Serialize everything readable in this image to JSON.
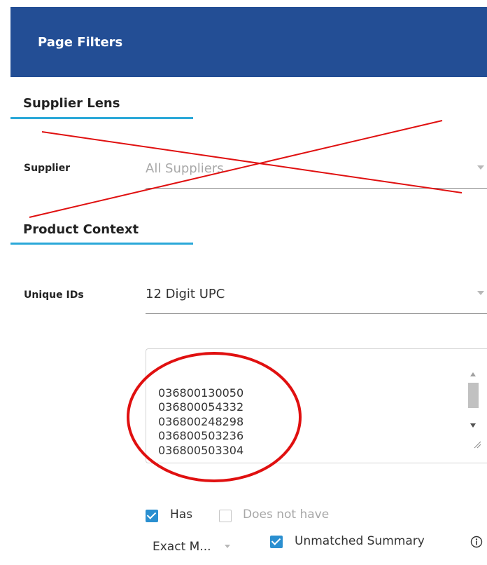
{
  "header": {
    "title": "Page Filters"
  },
  "supplier_lens": {
    "section_title": "Supplier Lens",
    "supplier_label": "Supplier",
    "supplier_value": "All Suppliers"
  },
  "product_context": {
    "section_title": "Product Context",
    "unique_ids_label": "Unique IDs",
    "unique_ids_value": "12 Digit UPC",
    "upc_lines": [
      "036800130050",
      "036800054332",
      "036800248298",
      "036800503236",
      "036800503304"
    ]
  },
  "filters": {
    "has_label": "Has",
    "has_checked": true,
    "does_not_have_label": "Does not have",
    "does_not_have_checked": false,
    "match_mode_value": "Exact M...",
    "unmatched_summary_label": "Unmatched Summary",
    "unmatched_summary_checked": true
  },
  "icons": {
    "info": "info-icon",
    "caret": "chevron-down-icon"
  },
  "annotation_color": "#e01010",
  "colors": {
    "header_bg": "#234e95",
    "accent_underline": "#2aa8d8",
    "checkbox": "#2a8fd0"
  }
}
